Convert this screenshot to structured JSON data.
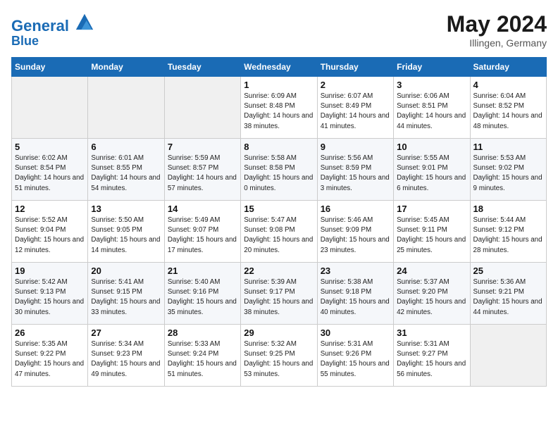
{
  "header": {
    "logo_line1": "General",
    "logo_line2": "Blue",
    "month": "May 2024",
    "location": "Illingen, Germany"
  },
  "days_of_week": [
    "Sunday",
    "Monday",
    "Tuesday",
    "Wednesday",
    "Thursday",
    "Friday",
    "Saturday"
  ],
  "weeks": [
    [
      null,
      null,
      null,
      {
        "day": 1,
        "sunrise": "6:09 AM",
        "sunset": "8:48 PM",
        "daylight": "14 hours and 38 minutes."
      },
      {
        "day": 2,
        "sunrise": "6:07 AM",
        "sunset": "8:49 PM",
        "daylight": "14 hours and 41 minutes."
      },
      {
        "day": 3,
        "sunrise": "6:06 AM",
        "sunset": "8:51 PM",
        "daylight": "14 hours and 44 minutes."
      },
      {
        "day": 4,
        "sunrise": "6:04 AM",
        "sunset": "8:52 PM",
        "daylight": "14 hours and 48 minutes."
      }
    ],
    [
      {
        "day": 5,
        "sunrise": "6:02 AM",
        "sunset": "8:54 PM",
        "daylight": "14 hours and 51 minutes."
      },
      {
        "day": 6,
        "sunrise": "6:01 AM",
        "sunset": "8:55 PM",
        "daylight": "14 hours and 54 minutes."
      },
      {
        "day": 7,
        "sunrise": "5:59 AM",
        "sunset": "8:57 PM",
        "daylight": "14 hours and 57 minutes."
      },
      {
        "day": 8,
        "sunrise": "5:58 AM",
        "sunset": "8:58 PM",
        "daylight": "15 hours and 0 minutes."
      },
      {
        "day": 9,
        "sunrise": "5:56 AM",
        "sunset": "8:59 PM",
        "daylight": "15 hours and 3 minutes."
      },
      {
        "day": 10,
        "sunrise": "5:55 AM",
        "sunset": "9:01 PM",
        "daylight": "15 hours and 6 minutes."
      },
      {
        "day": 11,
        "sunrise": "5:53 AM",
        "sunset": "9:02 PM",
        "daylight": "15 hours and 9 minutes."
      }
    ],
    [
      {
        "day": 12,
        "sunrise": "5:52 AM",
        "sunset": "9:04 PM",
        "daylight": "15 hours and 12 minutes."
      },
      {
        "day": 13,
        "sunrise": "5:50 AM",
        "sunset": "9:05 PM",
        "daylight": "15 hours and 14 minutes."
      },
      {
        "day": 14,
        "sunrise": "5:49 AM",
        "sunset": "9:07 PM",
        "daylight": "15 hours and 17 minutes."
      },
      {
        "day": 15,
        "sunrise": "5:47 AM",
        "sunset": "9:08 PM",
        "daylight": "15 hours and 20 minutes."
      },
      {
        "day": 16,
        "sunrise": "5:46 AM",
        "sunset": "9:09 PM",
        "daylight": "15 hours and 23 minutes."
      },
      {
        "day": 17,
        "sunrise": "5:45 AM",
        "sunset": "9:11 PM",
        "daylight": "15 hours and 25 minutes."
      },
      {
        "day": 18,
        "sunrise": "5:44 AM",
        "sunset": "9:12 PM",
        "daylight": "15 hours and 28 minutes."
      }
    ],
    [
      {
        "day": 19,
        "sunrise": "5:42 AM",
        "sunset": "9:13 PM",
        "daylight": "15 hours and 30 minutes."
      },
      {
        "day": 20,
        "sunrise": "5:41 AM",
        "sunset": "9:15 PM",
        "daylight": "15 hours and 33 minutes."
      },
      {
        "day": 21,
        "sunrise": "5:40 AM",
        "sunset": "9:16 PM",
        "daylight": "15 hours and 35 minutes."
      },
      {
        "day": 22,
        "sunrise": "5:39 AM",
        "sunset": "9:17 PM",
        "daylight": "15 hours and 38 minutes."
      },
      {
        "day": 23,
        "sunrise": "5:38 AM",
        "sunset": "9:18 PM",
        "daylight": "15 hours and 40 minutes."
      },
      {
        "day": 24,
        "sunrise": "5:37 AM",
        "sunset": "9:20 PM",
        "daylight": "15 hours and 42 minutes."
      },
      {
        "day": 25,
        "sunrise": "5:36 AM",
        "sunset": "9:21 PM",
        "daylight": "15 hours and 44 minutes."
      }
    ],
    [
      {
        "day": 26,
        "sunrise": "5:35 AM",
        "sunset": "9:22 PM",
        "daylight": "15 hours and 47 minutes."
      },
      {
        "day": 27,
        "sunrise": "5:34 AM",
        "sunset": "9:23 PM",
        "daylight": "15 hours and 49 minutes."
      },
      {
        "day": 28,
        "sunrise": "5:33 AM",
        "sunset": "9:24 PM",
        "daylight": "15 hours and 51 minutes."
      },
      {
        "day": 29,
        "sunrise": "5:32 AM",
        "sunset": "9:25 PM",
        "daylight": "15 hours and 53 minutes."
      },
      {
        "day": 30,
        "sunrise": "5:31 AM",
        "sunset": "9:26 PM",
        "daylight": "15 hours and 55 minutes."
      },
      {
        "day": 31,
        "sunrise": "5:31 AM",
        "sunset": "9:27 PM",
        "daylight": "15 hours and 56 minutes."
      },
      null
    ]
  ]
}
